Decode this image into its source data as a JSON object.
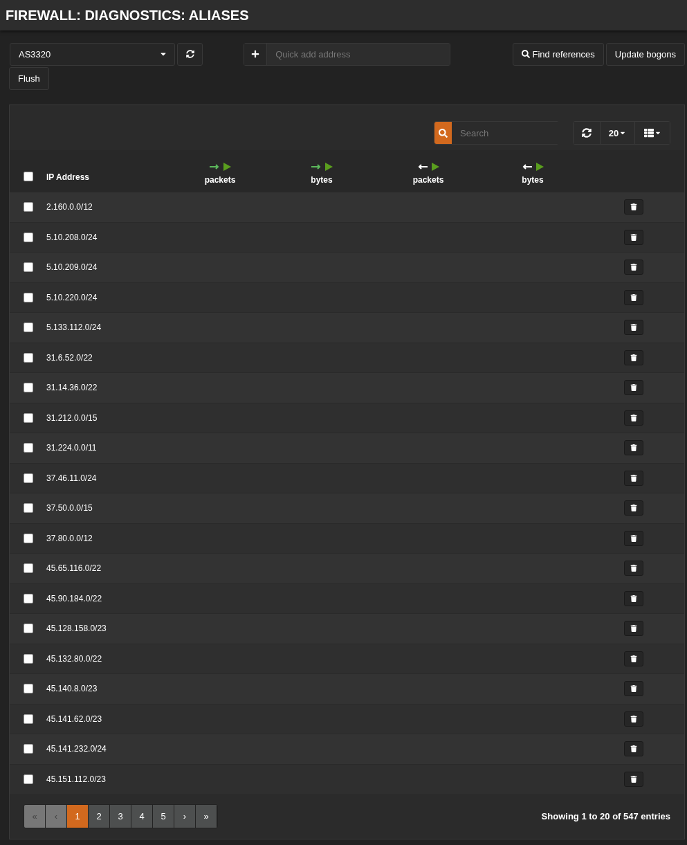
{
  "header": {
    "title": "FIREWALL: DIAGNOSTICS: ALIASES"
  },
  "toolbar": {
    "alias_select": "AS3320",
    "quick_add": {
      "placeholder": "Quick add address"
    },
    "find_references": "Find references",
    "update_bogons": "Update bogons",
    "flush": "Flush"
  },
  "grid": {
    "search": {
      "placeholder": "Search"
    },
    "page_size": "20",
    "columns": [
      {
        "kind": "ip",
        "label": "IP Address"
      },
      {
        "kind": "in",
        "label": "packets"
      },
      {
        "kind": "in",
        "label": "bytes"
      },
      {
        "kind": "out",
        "label": "packets"
      },
      {
        "kind": "out",
        "label": "bytes"
      }
    ],
    "rows": [
      {
        "ip": "2.160.0.0/12",
        "checked": false
      },
      {
        "ip": "5.10.208.0/24",
        "checked": false
      },
      {
        "ip": "5.10.209.0/24",
        "checked": false
      },
      {
        "ip": "5.10.220.0/24",
        "checked": false
      },
      {
        "ip": "5.133.112.0/24",
        "checked": false
      },
      {
        "ip": "31.6.52.0/22",
        "checked": false
      },
      {
        "ip": "31.14.36.0/22",
        "checked": false
      },
      {
        "ip": "31.212.0.0/15",
        "checked": false
      },
      {
        "ip": "31.224.0.0/11",
        "checked": false
      },
      {
        "ip": "37.46.11.0/24",
        "checked": false
      },
      {
        "ip": "37.50.0.0/15",
        "checked": false
      },
      {
        "ip": "37.80.0.0/12",
        "checked": false
      },
      {
        "ip": "45.65.116.0/22",
        "checked": false
      },
      {
        "ip": "45.90.184.0/22",
        "checked": false
      },
      {
        "ip": "45.128.158.0/23",
        "checked": false
      },
      {
        "ip": "45.132.80.0/22",
        "checked": false
      },
      {
        "ip": "45.140.8.0/23",
        "checked": false
      },
      {
        "ip": "45.141.62.0/23",
        "checked": false
      },
      {
        "ip": "45.141.232.0/24",
        "checked": false
      },
      {
        "ip": "45.151.112.0/23",
        "checked": false
      }
    ],
    "select_all": {
      "checked": false
    },
    "pagination": [
      {
        "label": "«",
        "selected": false,
        "disabled": true
      },
      {
        "label": "‹",
        "selected": false,
        "disabled": true
      },
      {
        "label": "1",
        "selected": true,
        "disabled": false
      },
      {
        "label": "2",
        "selected": false,
        "disabled": false
      },
      {
        "label": "3",
        "selected": false,
        "disabled": false
      },
      {
        "label": "4",
        "selected": false,
        "disabled": false
      },
      {
        "label": "5",
        "selected": false,
        "disabled": false
      },
      {
        "label": "›",
        "selected": false,
        "disabled": false
      },
      {
        "label": "»",
        "selected": false,
        "disabled": false
      }
    ],
    "info": "Showing 1 to 20 of 547 entries"
  }
}
